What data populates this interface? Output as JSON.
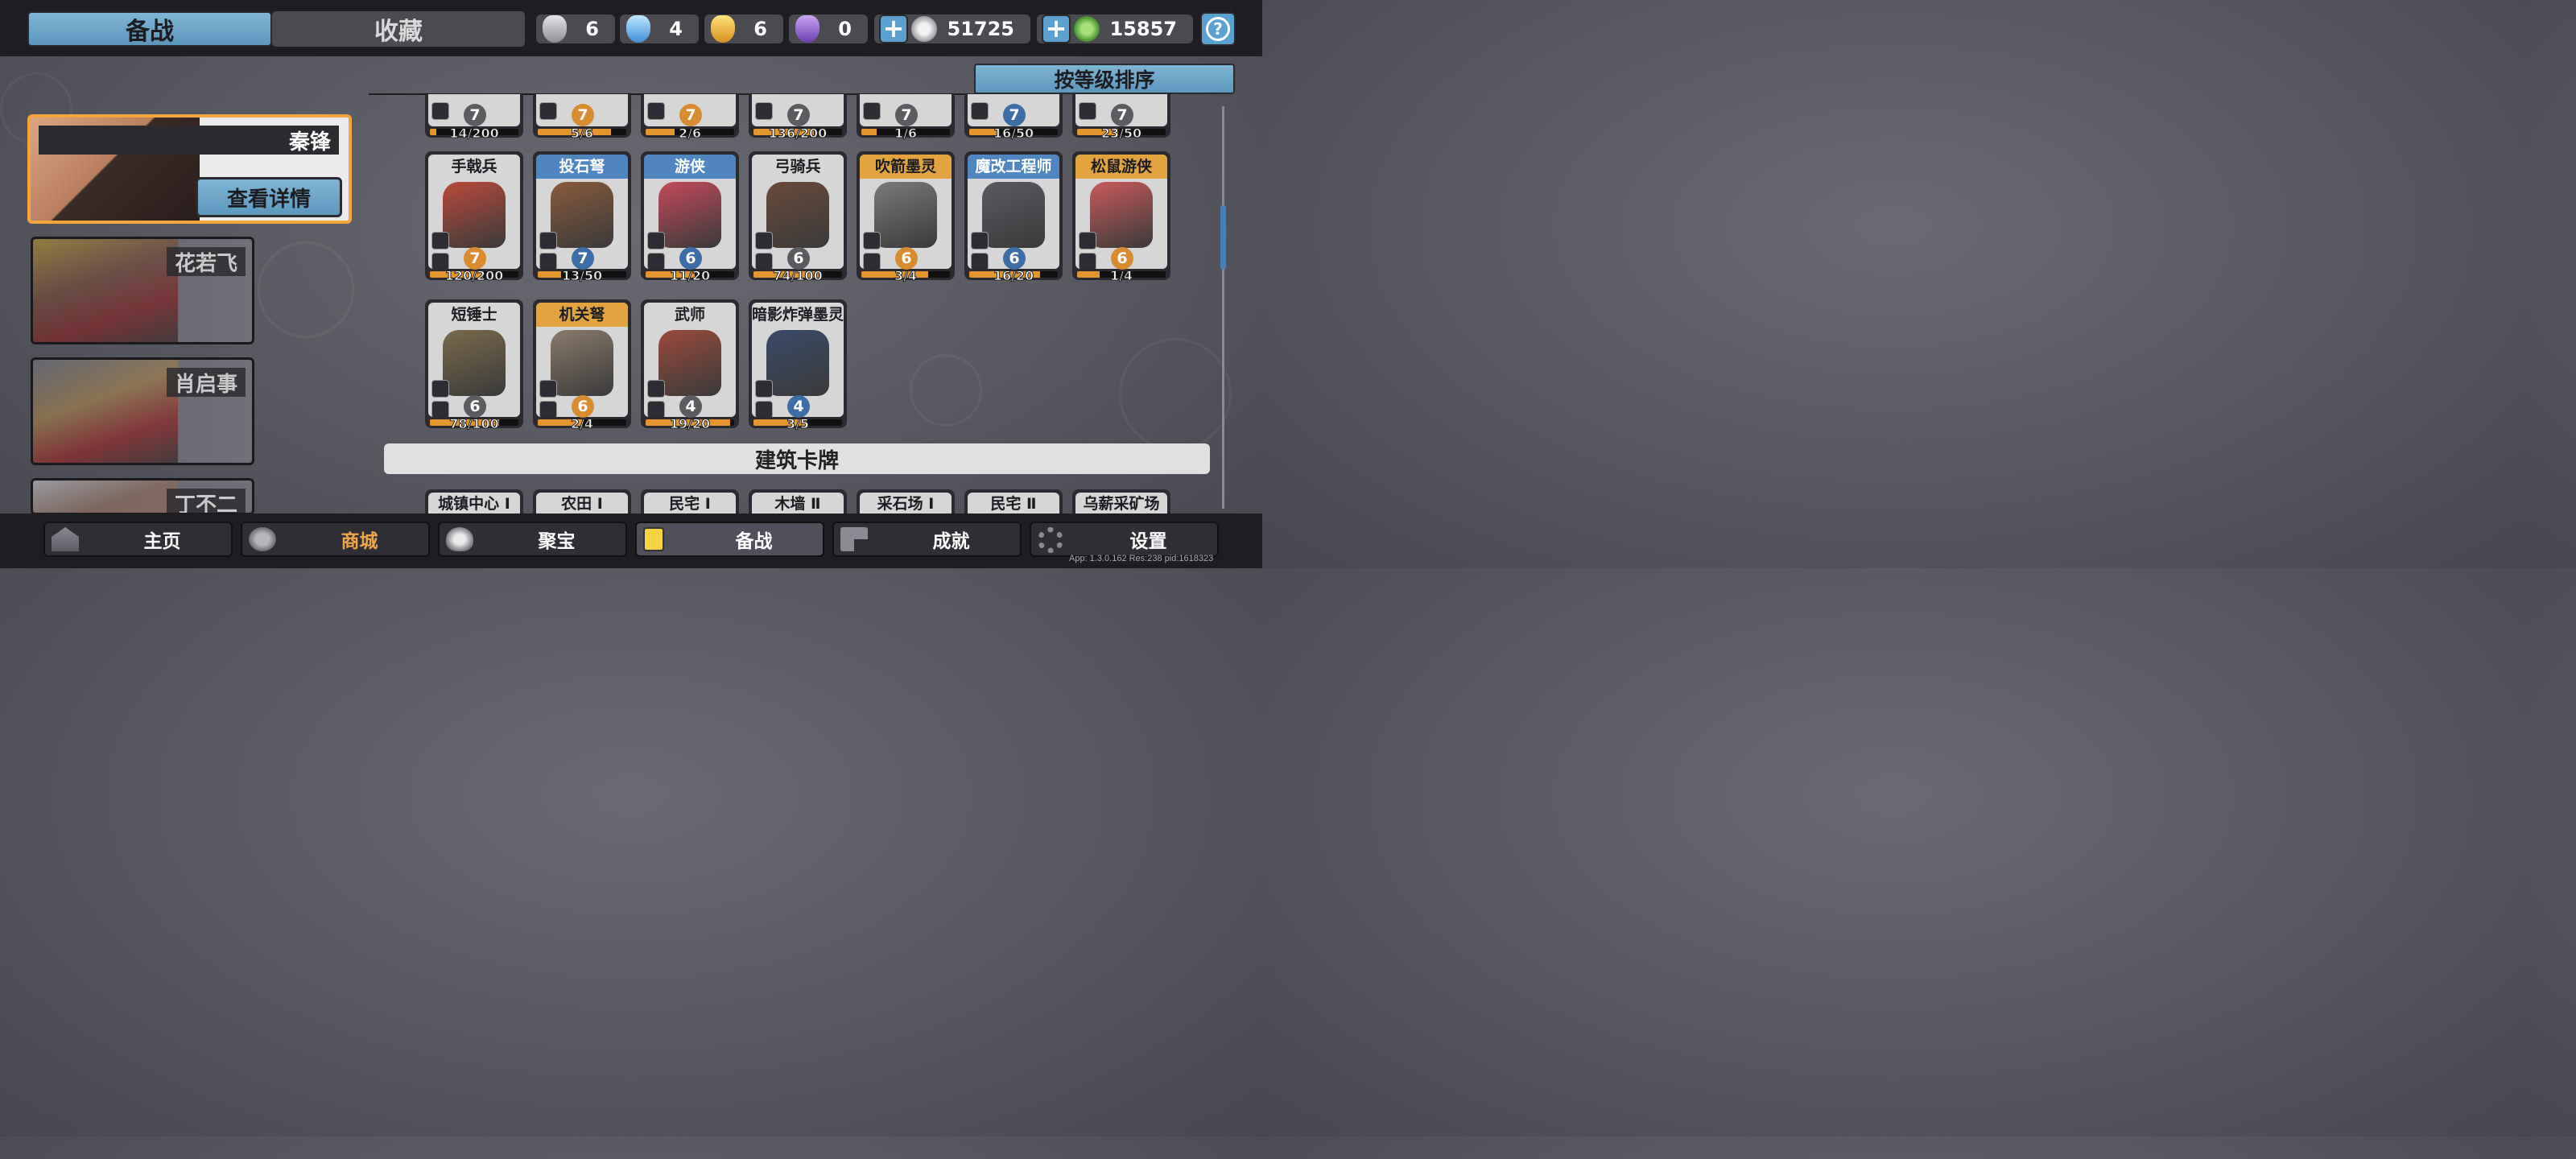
{
  "tabs": [
    {
      "label": "备战",
      "active": true
    },
    {
      "label": "收藏",
      "active": false
    }
  ],
  "resources": [
    {
      "icon": "silver-badge-icon",
      "value": "6"
    },
    {
      "icon": "crystal-badge-icon",
      "value": "4"
    },
    {
      "icon": "gold-badge-icon",
      "value": "6"
    },
    {
      "icon": "purple-badge-icon",
      "value": "0"
    },
    {
      "icon": "silver-coin-icon",
      "value": "51725"
    },
    {
      "icon": "jade-coin-icon",
      "value": "15857"
    }
  ],
  "sort_label": "按等级排序",
  "heroes": [
    {
      "name": "秦锋",
      "selected": true,
      "detail_label": "查看详情"
    },
    {
      "name": "花若飞",
      "selected": false
    },
    {
      "name": "肖启事",
      "selected": false
    },
    {
      "name": "丁不二",
      "selected": false
    }
  ],
  "partial_row": [
    {
      "level": "7",
      "progress": "14/200",
      "fill": 0.07
    },
    {
      "level": "7",
      "progress": "5/6",
      "fill": 0.83
    },
    {
      "level": "7",
      "progress": "2/6",
      "fill": 0.33
    },
    {
      "level": "7",
      "progress": "136/200",
      "fill": 0.68
    },
    {
      "level": "7",
      "progress": "1/6",
      "fill": 0.17
    },
    {
      "level": "7",
      "progress": "16/50",
      "fill": 0.32
    },
    {
      "level": "7",
      "progress": "23/50",
      "fill": 0.46
    }
  ],
  "unit_cards": [
    {
      "name": "手戟兵",
      "level": "7",
      "progress": "120/200",
      "fill": 0.6,
      "rarity": "common"
    },
    {
      "name": "投石弩",
      "level": "7",
      "progress": "13/50",
      "fill": 0.26,
      "rarity": "rare"
    },
    {
      "name": "游侠",
      "level": "6",
      "progress": "11/20",
      "fill": 0.55,
      "rarity": "rare"
    },
    {
      "name": "弓骑兵",
      "level": "6",
      "progress": "74/100",
      "fill": 0.74,
      "rarity": "common"
    },
    {
      "name": "吹箭墨灵",
      "level": "6",
      "progress": "3/4",
      "fill": 0.75,
      "rarity": "epic"
    },
    {
      "name": "魔改工程师",
      "level": "6",
      "progress": "16/20",
      "fill": 0.8,
      "rarity": "rare"
    },
    {
      "name": "松鼠游侠",
      "level": "6",
      "progress": "1/4",
      "fill": 0.25,
      "rarity": "epic"
    },
    {
      "name": "短锤士",
      "level": "6",
      "progress": "78/100",
      "fill": 0.78,
      "rarity": "common"
    },
    {
      "name": "机关弩",
      "level": "6",
      "progress": "2/4",
      "fill": 0.5,
      "rarity": "epic"
    },
    {
      "name": "武师",
      "level": "4",
      "progress": "19/20",
      "fill": 0.95,
      "rarity": "common"
    },
    {
      "name": "暗影炸弹墨灵",
      "level": "4",
      "progress": "3/5",
      "fill": 0.6,
      "rarity": "common"
    }
  ],
  "building_section_title": "建筑卡牌",
  "building_cards": [
    "城镇中心 Ⅰ",
    "农田 Ⅰ",
    "民宅 Ⅰ",
    "木墙 Ⅱ",
    "采石场 Ⅰ",
    "民宅 Ⅱ",
    "乌薪采矿场"
  ],
  "nav": [
    {
      "label": "主页",
      "icon": "home-icon"
    },
    {
      "label": "商城",
      "icon": "coins-icon"
    },
    {
      "label": "聚宝",
      "icon": "treasure-icon"
    },
    {
      "label": "备战",
      "icon": "cards-icon",
      "active": true
    },
    {
      "label": "成就",
      "icon": "achievement-icon"
    },
    {
      "label": "设置",
      "icon": "gear-icon"
    }
  ],
  "version_text": "App: 1.3.0.162 Res:238 pid:1618323",
  "colors": {
    "accent_blue": "#5c97bd",
    "selected_orange": "#f4a53c",
    "progress_orange": "#e3962e",
    "shop_orange": "#f2a64a"
  }
}
